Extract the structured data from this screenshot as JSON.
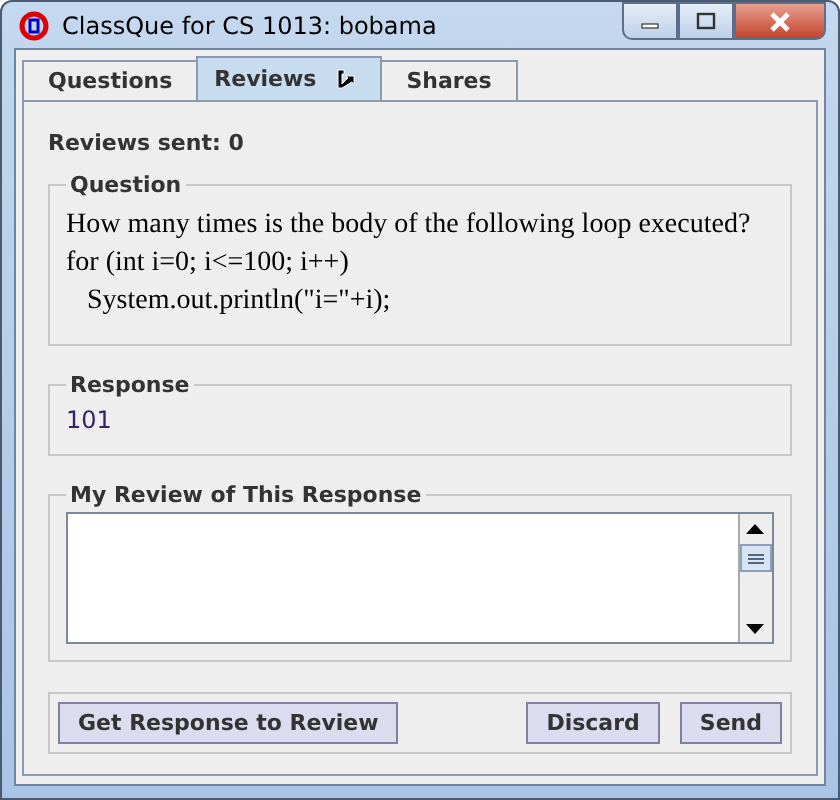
{
  "window": {
    "title": "ClassQue for CS 1013: bobama"
  },
  "tabs": [
    {
      "label": "Questions",
      "selected": false
    },
    {
      "label": "Reviews",
      "selected": true
    },
    {
      "label": "Shares",
      "selected": false
    }
  ],
  "reviews_sent": "Reviews sent: 0",
  "question": {
    "legend": "Question",
    "lines": [
      "How many times is the body of the following loop executed?",
      "for (int i=0; i<=100; i++)",
      "   System.out.println(\"i=\"+i);"
    ]
  },
  "response": {
    "legend": "Response",
    "value": "101"
  },
  "review": {
    "legend": "My Review of This Response"
  },
  "buttons": [
    {
      "label": "Get Response to Review",
      "kind": "left"
    },
    {
      "label": "Discard",
      "kind": "right"
    },
    {
      "label": "Send",
      "kind": "right"
    }
  ]
}
